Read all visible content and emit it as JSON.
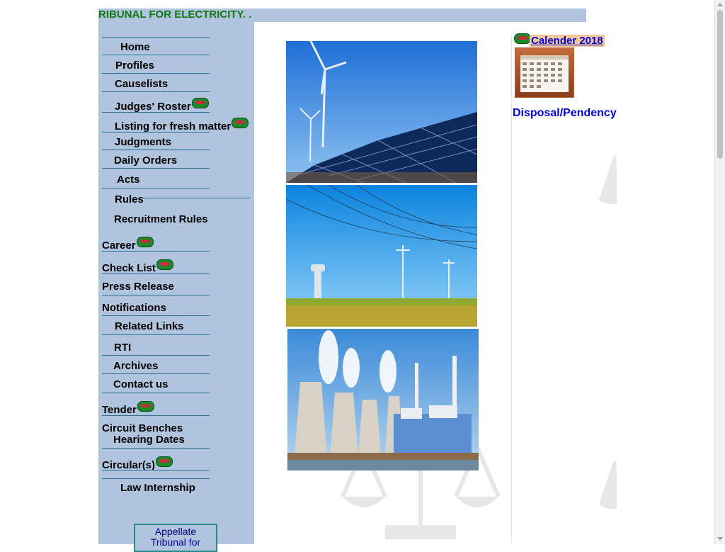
{
  "marquee": {
    "text": "RIBUNAL FOR ELECTRICITY. ."
  },
  "nav": {
    "home": "Home",
    "profiles": "Profiles",
    "causelists": "Causelists",
    "judges_roster": "Judges' Roster",
    "listing_fresh": "Listing for fresh matter",
    "judgments": "Judgments",
    "daily_orders": "Daily Orders",
    "acts": "Acts",
    "rules": "Rules",
    "recruitment_rules": "Recruitment Rules",
    "career": "Career",
    "check_list": "Check List",
    "press_release": "Press Release",
    "notifications": "Notifications",
    "related_links": "Related Links",
    "rti": "RTI",
    "archives": "Archives",
    "contact_us": "Contact us",
    "tender": "Tender",
    "circuit_benches_line1": "Circuit Benches",
    "circuit_benches_line2": "Hearing Dates",
    "circulars": "Circular(s)",
    "law_internship": "Law Internship"
  },
  "bottom_box": {
    "line1": "Appellate",
    "line2": "Tribunal for"
  },
  "right_panel": {
    "calendar_link": "Calender 2018",
    "disposal_link": "Disposal/Pendency"
  },
  "icons": {
    "new_badge": "new-badge-icon",
    "calendar": "calendar-icon"
  },
  "colors": {
    "sidebar_bg": "#b0c4de",
    "marquee_text": "#117711",
    "link_blue": "#0000dd",
    "divider": "#2e6e8e"
  }
}
